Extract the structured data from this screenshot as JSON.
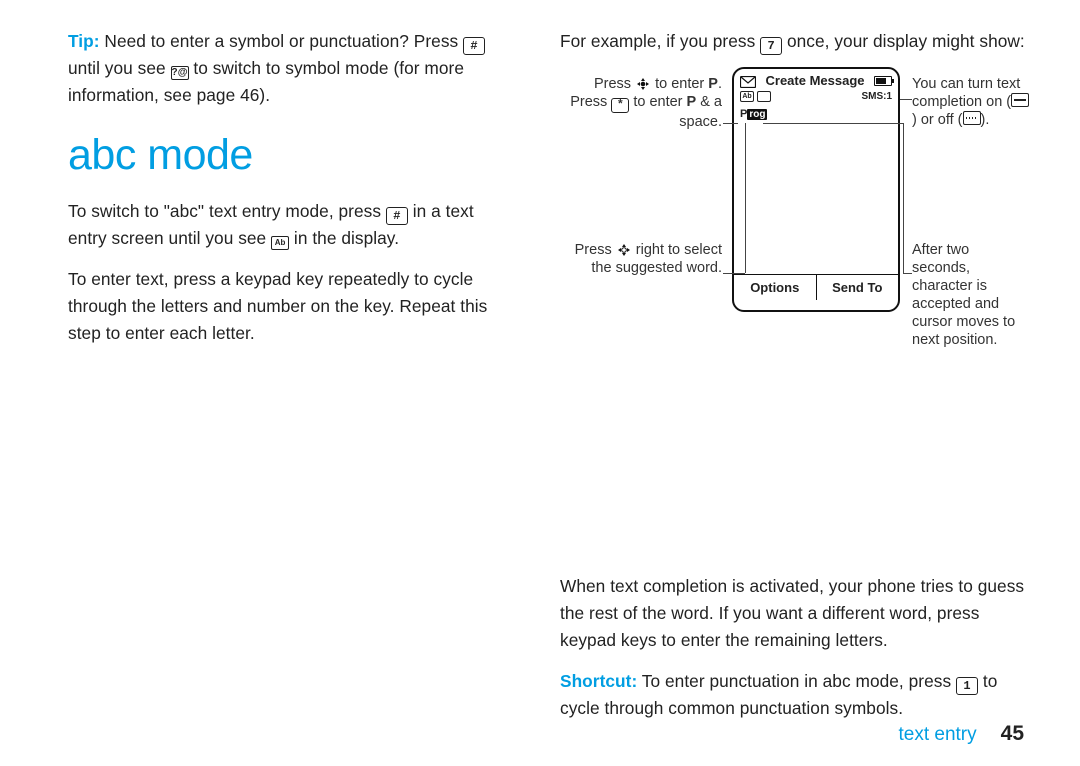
{
  "left": {
    "tip_label": "Tip:",
    "tip_text_1": " Need to enter a symbol or punctuation? Press ",
    "tip_key": "#",
    "tip_text_2": " until you see ",
    "tip_icon_label": "?@",
    "tip_text_3": " to switch to symbol mode (for more information, see page 46).",
    "heading": "abc mode",
    "p2a": "To switch to \"abc\" text entry mode, press ",
    "p2_key": "#",
    "p2b": " in a text entry screen until you see ",
    "p2_icon": "Ab",
    "p2c": " in the display.",
    "p3": "To enter text, press a keypad key repeatedly to cycle through the letters and number on the key. Repeat this step to enter each letter."
  },
  "right": {
    "intro_a": "For example, if you press ",
    "intro_key": "7",
    "intro_b": " once, your display might show:",
    "phone": {
      "title": "Create Message",
      "sms_label": "SMS:1",
      "row2_icon1": "Ab",
      "typed_char": "P",
      "suggested_rest": "rog",
      "soft_left": "Options",
      "soft_right": "Send To"
    },
    "ann_tl_1": "Press ",
    "ann_tl_2": " to enter ",
    "ann_tl_bold": "P",
    "ann_tl_3": ".",
    "ann_ml_1": "Press ",
    "ann_ml_key": "*",
    "ann_ml_2": " to enter ",
    "ann_ml_bold": "P",
    "ann_ml_3": " & a space.",
    "ann_bl_1": "Press ",
    "ann_bl_2": " right to select the suggested word.",
    "ann_tr_1": "You can turn text completion on (",
    "ann_tr_2": ") or off (",
    "ann_tr_3": ").",
    "ann_br": "After two seconds, character is accepted and cursor moves to next position.",
    "p_after": "When text completion is activated, your phone tries to guess the rest of the word. If you want a different word, press keypad keys to enter the remaining letters.",
    "shortcut_label": "Shortcut:",
    "shortcut_a": " To enter punctuation in abc mode, press ",
    "shortcut_key": "1",
    "shortcut_b": " to cycle through common punctuation symbols."
  },
  "footer": {
    "section": "text entry",
    "page": "45"
  }
}
